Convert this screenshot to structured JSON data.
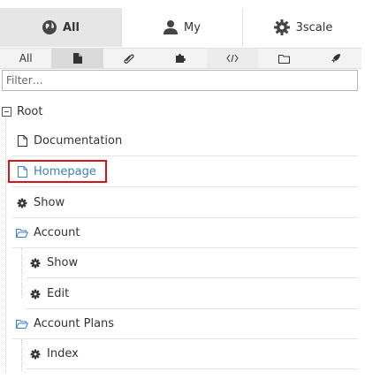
{
  "tabs": [
    {
      "label": "All",
      "icon": "globe-icon",
      "active": true
    },
    {
      "label": "My",
      "icon": "user-icon",
      "active": false
    },
    {
      "label": "3scale",
      "icon": "gear-icon",
      "active": false
    }
  ],
  "filters": [
    {
      "label": "All",
      "icon": null
    },
    {
      "label": "",
      "icon": "file-icon"
    },
    {
      "label": "",
      "icon": "paperclip-icon"
    },
    {
      "label": "",
      "icon": "puzzle-icon"
    },
    {
      "label": "",
      "icon": "code-icon"
    },
    {
      "label": "",
      "icon": "folder-icon"
    },
    {
      "label": "",
      "icon": "rocket-icon"
    }
  ],
  "filter_placeholder": "Filter…",
  "tree": {
    "root": "Root",
    "nodes": [
      {
        "label": "Documentation",
        "icon": "file-icon",
        "level": 1
      },
      {
        "label": "Homepage",
        "icon": "file-icon",
        "level": 1,
        "highlighted": true
      },
      {
        "label": "Show",
        "icon": "gear-icon",
        "level": 1
      },
      {
        "label": "Account",
        "icon": "folder-open-icon",
        "level": 1
      },
      {
        "label": "Show",
        "icon": "gear-icon",
        "level": 2
      },
      {
        "label": "Edit",
        "icon": "gear-icon",
        "level": 2
      },
      {
        "label": "Account Plans",
        "icon": "folder-open-icon",
        "level": 1
      },
      {
        "label": "Index",
        "icon": "gear-icon",
        "level": 2
      }
    ]
  },
  "colors": {
    "link": "#3b82c4",
    "highlight": "#d7141a",
    "tab_active_bg": "#e6e6e6"
  }
}
